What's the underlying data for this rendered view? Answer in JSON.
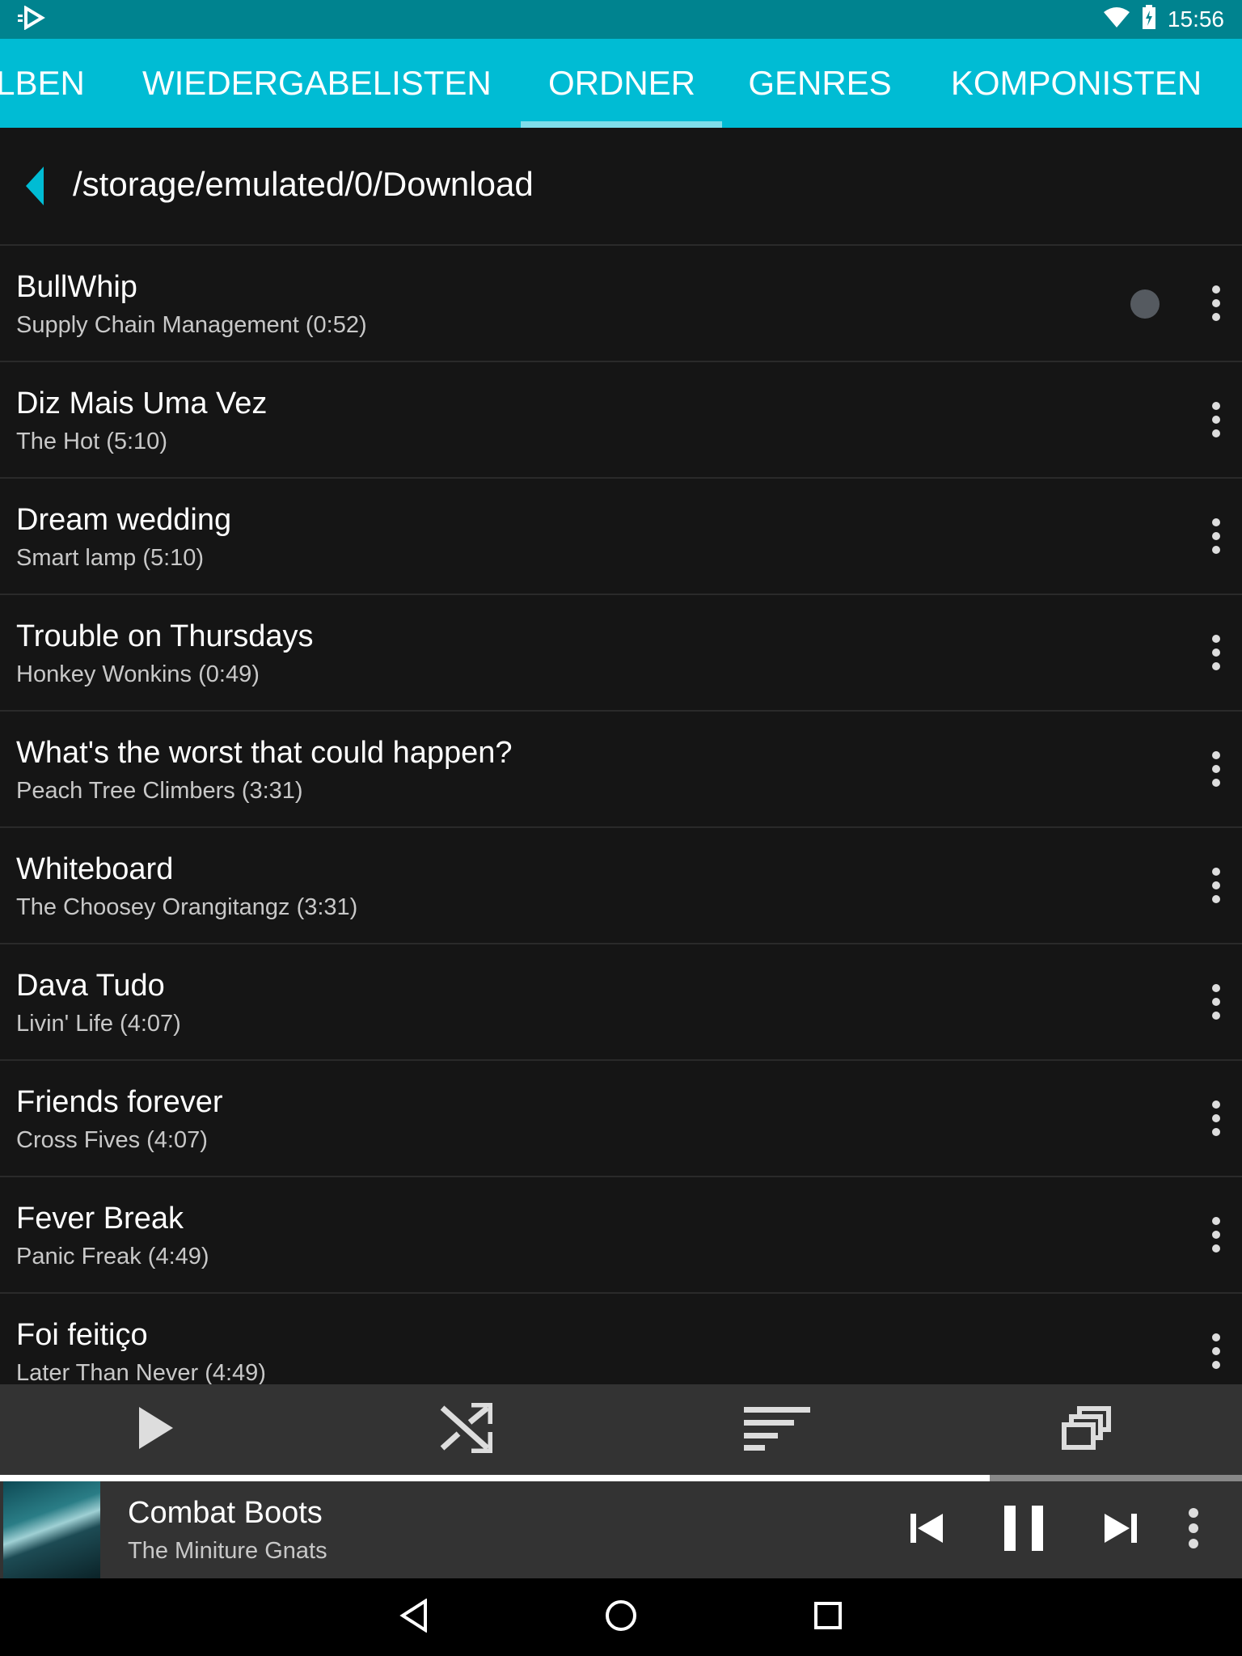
{
  "status_bar": {
    "time": "15:56",
    "icons": [
      "cast-icon",
      "wifi-icon",
      "battery-charging-icon"
    ]
  },
  "tabs": {
    "items": [
      {
        "label": "LBEN"
      },
      {
        "label": "WIEDERGABELISTEN"
      },
      {
        "label": "ORDNER"
      },
      {
        "label": "GENRES"
      },
      {
        "label": "KOMPONISTEN"
      }
    ],
    "active": "ORDNER"
  },
  "folder": {
    "path": "/storage/emulated/0/Download"
  },
  "songs": [
    {
      "title": "BullWhip",
      "subtitle": "Supply Chain Management (0:52)",
      "playing": true
    },
    {
      "title": "Diz Mais Uma Vez",
      "subtitle": "The Hot (5:10)"
    },
    {
      "title": "Dream wedding",
      "subtitle": "Smart lamp (5:10)"
    },
    {
      "title": "Trouble on Thursdays",
      "subtitle": "Honkey Wonkins (0:49)"
    },
    {
      "title": "What's the worst that could happen?",
      "subtitle": "Peach Tree Climbers (3:31)"
    },
    {
      "title": "Whiteboard",
      "subtitle": "The Choosey Orangitangz (3:31)"
    },
    {
      "title": "Dava Tudo",
      "subtitle": "Livin' Life (4:07)"
    },
    {
      "title": "Friends forever",
      "subtitle": "Cross Fives (4:07)"
    },
    {
      "title": "Fever Break",
      "subtitle": "Panic Freak (4:49)"
    },
    {
      "title": "Foi feitiço",
      "subtitle": "Later Than Never (4:49)"
    }
  ],
  "actions": [
    "play-icon",
    "shuffle-icon",
    "sort-icon",
    "queue-icon"
  ],
  "playback": {
    "progress": 0.797
  },
  "now_playing": {
    "title": "Combat Boots",
    "artist": "The Miniture Gnats"
  },
  "colors": {
    "status_bar": "#00838f",
    "tab_bar": "#00bcd4",
    "tab_indicator": "#80deea",
    "accent": "#00bcd4",
    "background": "#151515"
  }
}
